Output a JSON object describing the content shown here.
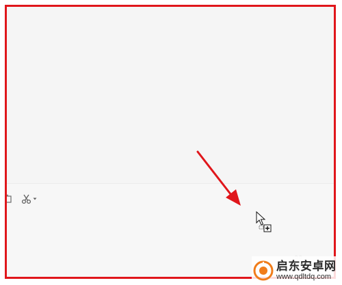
{
  "window": {
    "frame_color": "#e0161b",
    "background": "#f7f7f7"
  },
  "toolbar": {
    "items": [
      {
        "name": "folder-icon"
      },
      {
        "name": "scissors-icon",
        "has_dropdown": true
      }
    ]
  },
  "annotation": {
    "arrow_color": "#e0161b"
  },
  "cursor": {
    "icon": "drag-copy-cursor-icon"
  },
  "watermark": {
    "name": "启东安卓网",
    "url": "www.qdltdq.com",
    "logo_color": "#f07c1a"
  }
}
